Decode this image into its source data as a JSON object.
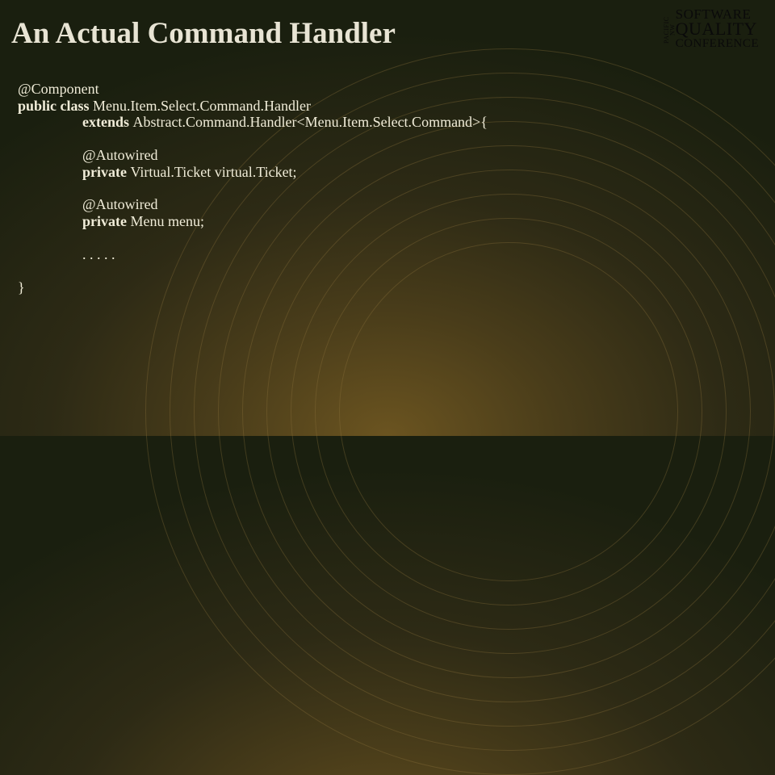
{
  "title": "An Actual Command Handler",
  "logo": {
    "vertical": "PACIFIC NW",
    "line1": "SOFTWARE",
    "line2": "QUALITY",
    "line3": "CONFERENCE"
  },
  "code": {
    "l1": "@Component",
    "l2a": "public class ",
    "l2b": "Menu.Item.Select.Command.Handler",
    "l3a": "extends ",
    "l3b": "Abstract.Command.Handler<Menu.Item.Select.Command>{",
    "l4": "@Autowired",
    "l5a": "private ",
    "l5b": "Virtual.Ticket virtual.Ticket;",
    "l6": "@Autowired",
    "l7a": "private ",
    "l7b": "Menu menu;",
    "l8": ". . . . .",
    "l9": "}"
  }
}
